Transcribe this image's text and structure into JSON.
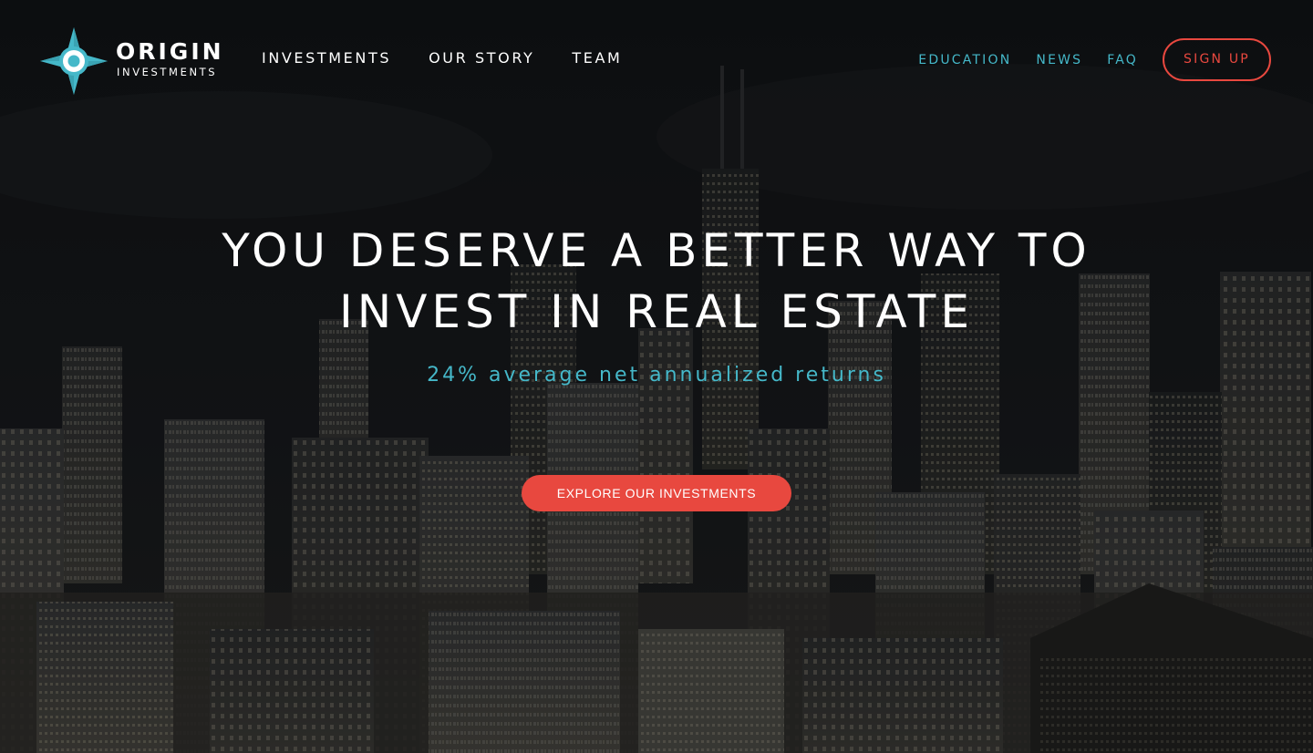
{
  "brand": {
    "name": "ORIGIN",
    "subname": "INVESTMENTS",
    "logo_icon": "compass-star-icon",
    "colors": {
      "teal": "#45b8c9",
      "coral": "#e8483f",
      "white": "#ffffff"
    }
  },
  "nav": {
    "primary": [
      {
        "label": "INVESTMENTS"
      },
      {
        "label": "OUR STORY"
      },
      {
        "label": "TEAM"
      }
    ],
    "secondary": [
      {
        "label": "EDUCATION"
      },
      {
        "label": "NEWS"
      },
      {
        "label": "FAQ"
      }
    ],
    "signup_label": "SIGN UP"
  },
  "hero": {
    "title_line1": "YOU DESERVE A BETTER WAY TO",
    "title_line2": "INVEST IN REAL ESTATE",
    "subtitle": "24% average net annualized returns",
    "cta_label": "EXPLORE OUR INVESTMENTS"
  }
}
